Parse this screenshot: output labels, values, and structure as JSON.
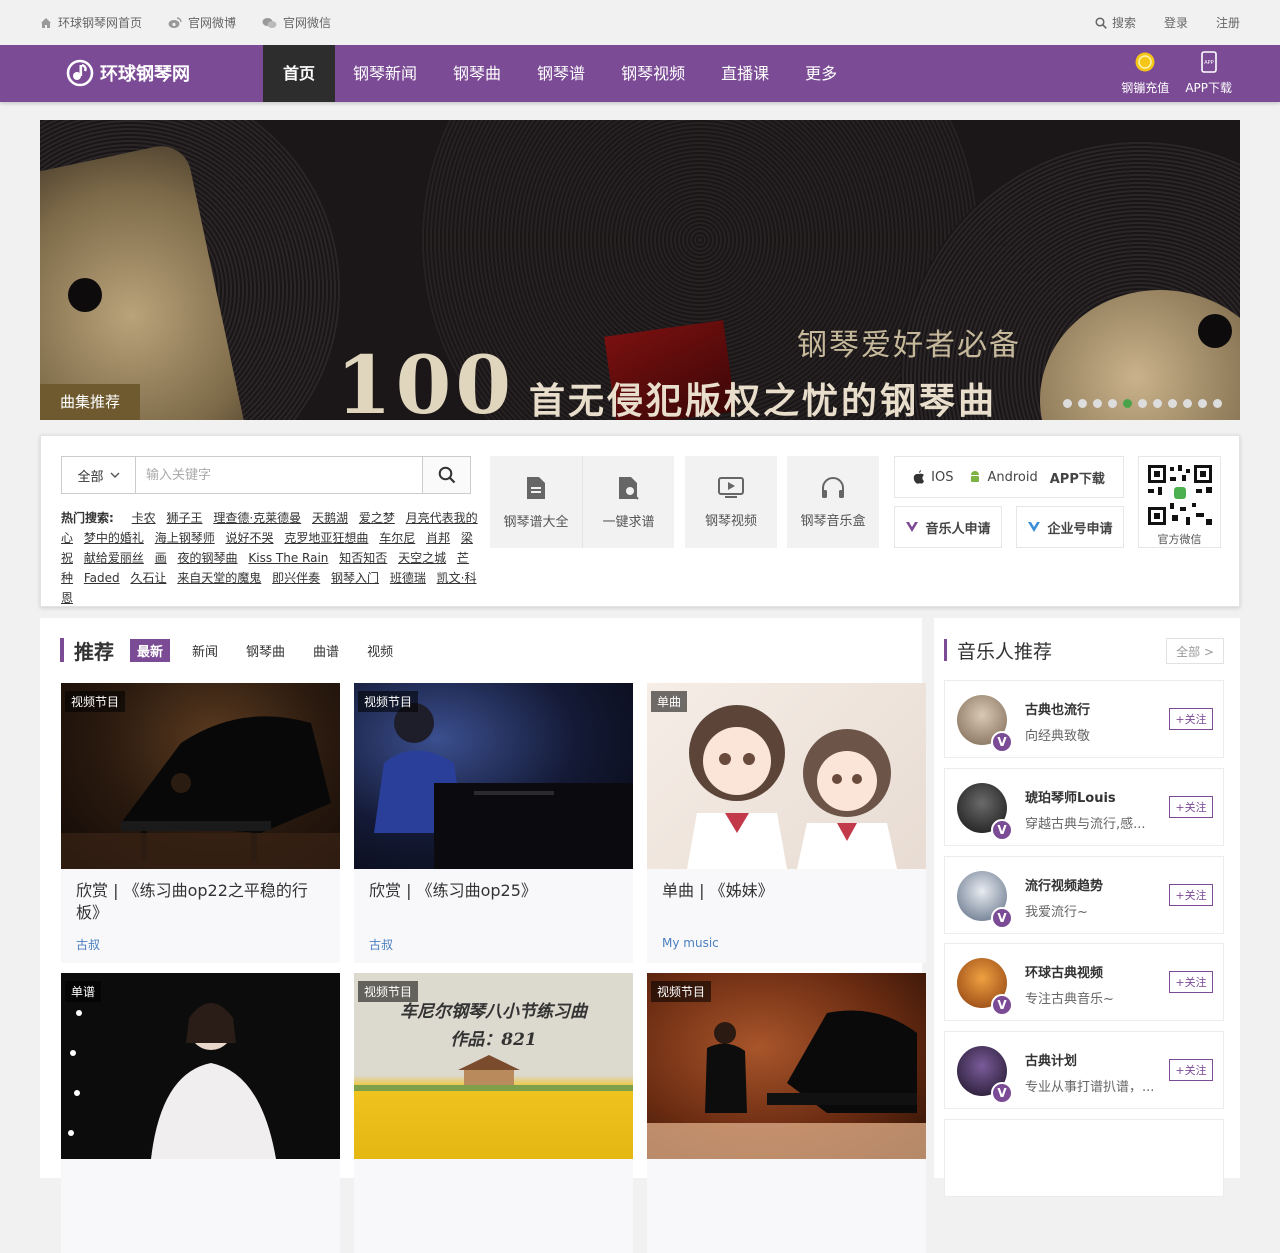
{
  "topbar": {
    "home": "环球钢琴网首页",
    "weibo": "官网微博",
    "wechat": "官网微信",
    "search": "搜索",
    "login": "登录",
    "register": "注册"
  },
  "nav": {
    "logo": "环球钢琴网",
    "items": [
      "首页",
      "钢琴新闻",
      "钢琴曲",
      "钢琴谱",
      "钢琴视频",
      "直播课",
      "更多"
    ],
    "recharge": "钢镚充值",
    "app": "APP下载",
    "app_icon_text": "APP"
  },
  "banner": {
    "subtitle": "钢琴爱好者必备",
    "number": "100",
    "headline": "首无侵犯版权之忧的钢琴曲",
    "tag": "曲集推荐",
    "dot_count": 11,
    "active_dot": 4
  },
  "tools": {
    "search_scope": "全部",
    "search_placeholder": "输入关键字",
    "hot_label": "热门搜索:",
    "hot_keywords": [
      "卡农",
      "狮子王",
      "理查德·克莱德曼",
      "天鹅湖",
      "爱之梦",
      "月亮代表我的心",
      "梦中的婚礼",
      "海上钢琴师",
      "说好不哭",
      "克罗地亚狂想曲",
      "车尔尼",
      "肖邦",
      "梁祝",
      "献给爱丽丝",
      "画",
      "夜的钢琴曲",
      "Kiss The Rain",
      "知否知否",
      "天空之城",
      "芒种",
      "Faded",
      "久石让",
      "来自天堂的魔鬼",
      "即兴伴奏",
      "钢琴入门",
      "班德瑞",
      "凯文·科恩"
    ],
    "cards": [
      "钢琴谱大全",
      "一键求谱",
      "钢琴视频",
      "钢琴音乐盒"
    ],
    "ios": "IOS",
    "android": "Android",
    "app_download": "APP下载",
    "musician_apply": "音乐人申请",
    "enterprise_apply": "企业号申请",
    "qr_label": "官方微信"
  },
  "main": {
    "title": "推荐",
    "tabs": [
      "最新",
      "新闻",
      "钢琴曲",
      "曲谱",
      "视频"
    ],
    "cards": [
      {
        "badge": "视频节目",
        "title": "欣赏 | 《练习曲op22之平稳的行板》",
        "author": "古叔"
      },
      {
        "badge": "视频节目",
        "title": "欣赏 | 《练习曲op25》",
        "author": "古叔"
      },
      {
        "badge": "单曲",
        "title": "单曲 | 《姊妹》",
        "author": "My music"
      },
      {
        "badge": "单谱",
        "title": "",
        "author": ""
      },
      {
        "badge": "视频节目",
        "title": "",
        "author": "",
        "poster_line1": "车尼尔钢琴八小节练习曲",
        "poster_line2": "作品：821"
      },
      {
        "badge": "视频节目",
        "title": "",
        "author": ""
      }
    ]
  },
  "sidebar": {
    "title": "音乐人推荐",
    "all": "全部 >",
    "follow": "+关注",
    "verified": "V",
    "musicians": [
      {
        "name": "古典也流行",
        "desc": "向经典致敬"
      },
      {
        "name": "琥珀琴师Louis",
        "desc": "穿越古典与流行,感..."
      },
      {
        "name": "流行视频趋势",
        "desc": "我爱流行~"
      },
      {
        "name": "环球古典视频",
        "desc": "专注古典音乐~"
      },
      {
        "name": "古典计划",
        "desc": "专业从事打谱扒谱，..."
      }
    ]
  },
  "colors": {
    "brand": "#7b4b95",
    "nav_active": "#2d2d2d",
    "link": "#4b7fc0"
  }
}
